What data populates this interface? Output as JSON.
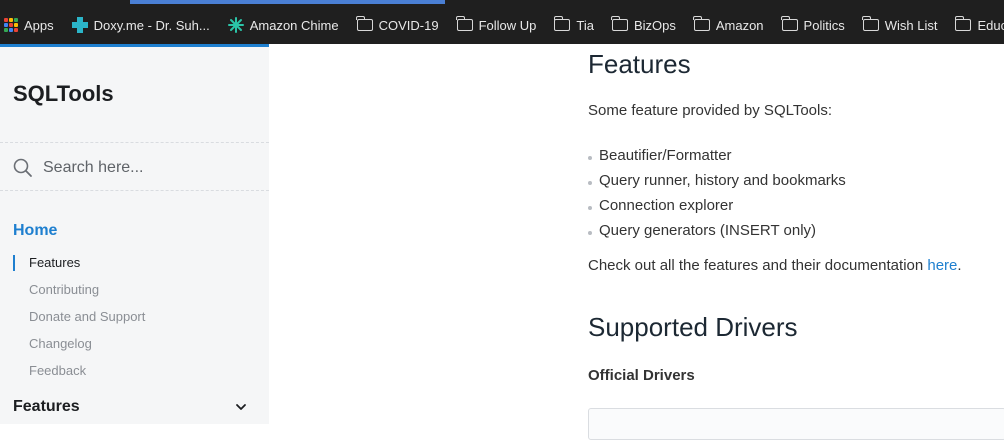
{
  "bookmarks": [
    {
      "label": "Apps",
      "icon": "apps-grid-icon"
    },
    {
      "label": "Doxy.me - Dr. Suh...",
      "icon": "doxy-plus-icon"
    },
    {
      "label": "Amazon Chime",
      "icon": "chime-icon"
    },
    {
      "label": "COVID-19",
      "icon": "folder-icon"
    },
    {
      "label": "Follow Up",
      "icon": "folder-icon"
    },
    {
      "label": "Tia",
      "icon": "folder-icon"
    },
    {
      "label": "BizOps",
      "icon": "folder-icon"
    },
    {
      "label": "Amazon",
      "icon": "folder-icon"
    },
    {
      "label": "Politics",
      "icon": "folder-icon"
    },
    {
      "label": "Wish List",
      "icon": "folder-icon"
    },
    {
      "label": "Educat",
      "icon": "folder-icon"
    }
  ],
  "colors": {
    "accent": "#1e7fcf",
    "sidebar_bg": "#f5f6f7",
    "bookmarks_bg": "#1f1f1f"
  },
  "sidebar": {
    "title": "SQLTools",
    "search_placeholder": "Search here...",
    "home_label": "Home",
    "subitems": [
      "Features",
      "Contributing",
      "Donate and Support",
      "Changelog",
      "Feedback"
    ],
    "active_subitem": "Features",
    "features_label": "Features"
  },
  "content": {
    "features_heading": "Features",
    "intro": "Some feature provided by SQLTools:",
    "bullets": [
      "Beautifier/Formatter",
      "Query runner, history and bookmarks",
      "Connection explorer",
      "Query generators (INSERT only)"
    ],
    "checkout_prefix": "Check out all the features and their documentation ",
    "checkout_link": "here",
    "checkout_suffix": ".",
    "drivers_heading": "Supported Drivers",
    "official_heading": "Official Drivers"
  }
}
